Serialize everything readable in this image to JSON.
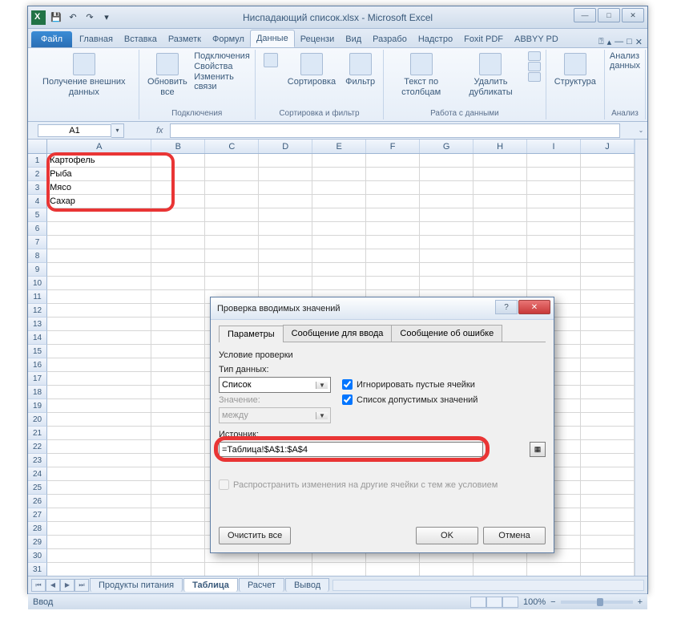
{
  "window": {
    "title": "Ниспадающий список.xlsx - Microsoft Excel"
  },
  "ribbon": {
    "file": "Файл",
    "tabs": [
      "Главная",
      "Вставка",
      "Разметк",
      "Формул",
      "Данные",
      "Рецензи",
      "Вид",
      "Разрабо",
      "Надстро",
      "Foxit PDF",
      "ABBYY PD"
    ],
    "active_tab": "Данные",
    "groups": {
      "g1": {
        "big": "Получение\nвнешних данных",
        "label": ""
      },
      "g2": {
        "big": "Обновить\nвсе",
        "items": [
          "Подключения",
          "Свойства",
          "Изменить связи"
        ],
        "label": "Подключения"
      },
      "g3": {
        "big1": "Сортировка",
        "big2": "Фильтр",
        "label": "Сортировка и фильтр"
      },
      "g4": {
        "big1": "Текст по\nстолбцам",
        "big2": "Удалить\nдубликаты",
        "label": "Работа с данными"
      },
      "g5": {
        "big": "Структура",
        "label": ""
      },
      "g6": {
        "item": "Анализ данных",
        "label": "Анализ"
      }
    }
  },
  "namebox": {
    "value": "A1",
    "fx": "fx"
  },
  "columns": [
    "A",
    "B",
    "C",
    "D",
    "E",
    "F",
    "G",
    "H",
    "I",
    "J"
  ],
  "cells": {
    "a1": "Картофель",
    "a2": "Рыба",
    "a3": "Мясо",
    "a4": "Сахар"
  },
  "sheets": {
    "tabs": [
      "Продукты питания",
      "Таблица",
      "Расчет",
      "Вывод"
    ],
    "active": "Таблица"
  },
  "status": {
    "mode": "Ввод",
    "zoom": "100%",
    "zoom_minus": "−",
    "zoom_plus": "+"
  },
  "dialog": {
    "title": "Проверка вводимых значений",
    "tabs": [
      "Параметры",
      "Сообщение для ввода",
      "Сообщение об ошибке"
    ],
    "group_label": "Условие проверки",
    "type_label": "Тип данных:",
    "type_value": "Список",
    "val_label": "Значение:",
    "val_value": "между",
    "chk_ignore": "Игнорировать пустые ячейки",
    "chk_list": "Список допустимых значений",
    "source_label": "Источник:",
    "source_value": "=Таблица!$A$1:$A$4",
    "propagate": "Распространить изменения на другие ячейки с тем же условием",
    "btn_clear": "Очистить все",
    "btn_ok": "OK",
    "btn_cancel": "Отмена"
  }
}
